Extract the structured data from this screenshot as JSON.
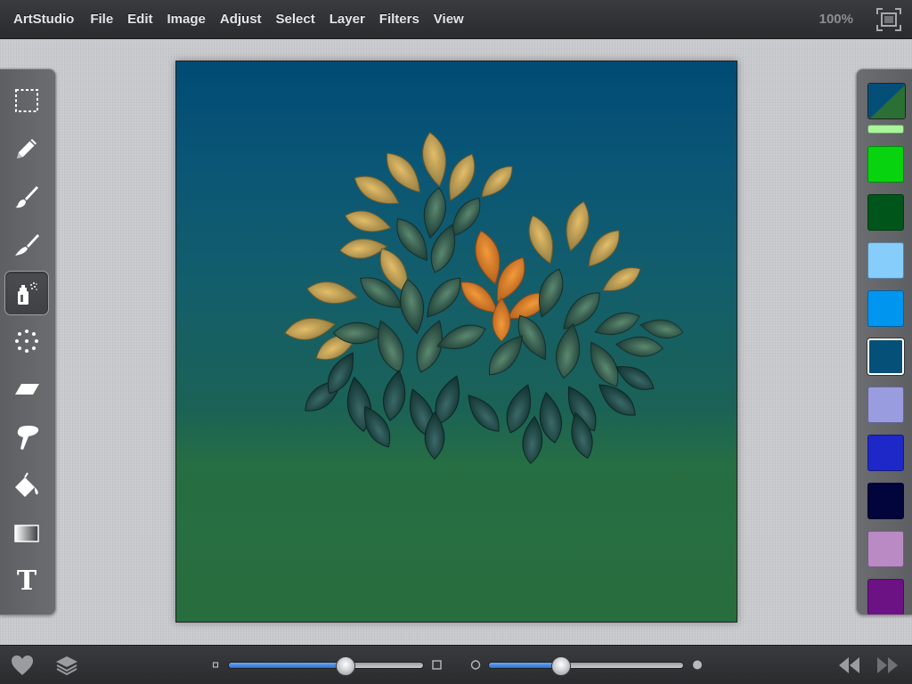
{
  "menubar": {
    "app_name": "ArtStudio",
    "items": [
      "File",
      "Edit",
      "Image",
      "Adjust",
      "Select",
      "Layer",
      "Filters",
      "View"
    ],
    "zoom": "100%"
  },
  "tools": [
    {
      "name": "marquee-select-icon",
      "active": false
    },
    {
      "name": "pencil-icon",
      "active": false
    },
    {
      "name": "paintbrush-icon",
      "active": false
    },
    {
      "name": "smudge-brush-icon",
      "active": false
    },
    {
      "name": "spray-can-icon",
      "active": true
    },
    {
      "name": "scatter-dots-icon",
      "active": false
    },
    {
      "name": "eraser-icon",
      "active": false
    },
    {
      "name": "smudge-finger-icon",
      "active": false
    },
    {
      "name": "paint-bucket-icon",
      "active": false
    },
    {
      "name": "gradient-icon",
      "active": false
    },
    {
      "name": "text-tool-icon",
      "active": false
    }
  ],
  "text_tool_glyph": "T",
  "palette": {
    "current_primary": "#044f78",
    "current_secondary": "#2a7035",
    "swatches": [
      {
        "color": "#a8f59a",
        "selected": false
      },
      {
        "color": "#07d40e",
        "selected": false
      },
      {
        "color": "#00561a",
        "selected": false
      },
      {
        "color": "#86cdfb",
        "selected": false
      },
      {
        "color": "#0096f0",
        "selected": false
      },
      {
        "color": "#045078",
        "selected": true
      },
      {
        "color": "#999ddf",
        "selected": false
      },
      {
        "color": "#1e27c8",
        "selected": false
      },
      {
        "color": "#02053c",
        "selected": false
      },
      {
        "color": "#b98ac4",
        "selected": false
      },
      {
        "color": "#6d1284",
        "selected": false
      }
    ]
  },
  "bottombar": {
    "brush_size": 0.6,
    "brush_opacity": 0.37
  }
}
